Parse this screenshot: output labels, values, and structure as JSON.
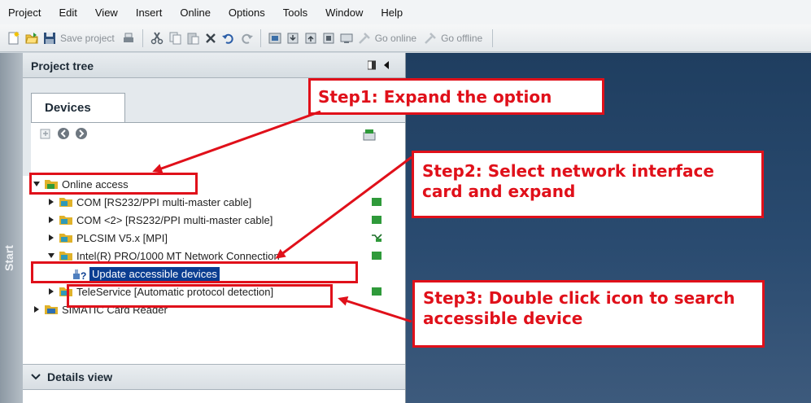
{
  "menu": [
    "Project",
    "Edit",
    "View",
    "Insert",
    "Online",
    "Options",
    "Tools",
    "Window",
    "Help"
  ],
  "toolbar": {
    "save_label": "Save project",
    "go_online_label": "Go online",
    "go_offline_label": "Go offline"
  },
  "sidestrip": {
    "label": "Start"
  },
  "tree": {
    "title": "Project tree",
    "tab": "Devices",
    "rows": [
      {
        "label": "Online access",
        "icon": "folder-network-icon"
      },
      {
        "label": "COM [RS232/PPI multi-master cable]",
        "icon": "interface-icon",
        "status": "green"
      },
      {
        "label": "COM <2> [RS232/PPI multi-master cable]",
        "icon": "interface-icon",
        "status": "green"
      },
      {
        "label": "PLCSIM V5.x [MPI]",
        "icon": "interface-icon",
        "status": "plcsim"
      },
      {
        "label": "Intel(R) PRO/1000 MT Network Connection",
        "icon": "interface-icon",
        "status": "green"
      },
      {
        "label": "Update accessible devices",
        "icon": "search-devices-icon"
      },
      {
        "label": "TeleService [Automatic protocol detection]",
        "icon": "interface-icon",
        "status": "green"
      },
      {
        "label": "SIMATIC Card Reader",
        "icon": "card-reader-icon"
      }
    ],
    "details_label": "Details view"
  },
  "callouts": {
    "step1": "Step1: Expand the option",
    "step2": "Step2: Select network interface card and expand",
    "step3": "Step3: Double click icon to search accessible device"
  },
  "colors": {
    "annotation": "#e0101a",
    "selection": "#0a3d91",
    "workarea": "#2a4b70"
  }
}
